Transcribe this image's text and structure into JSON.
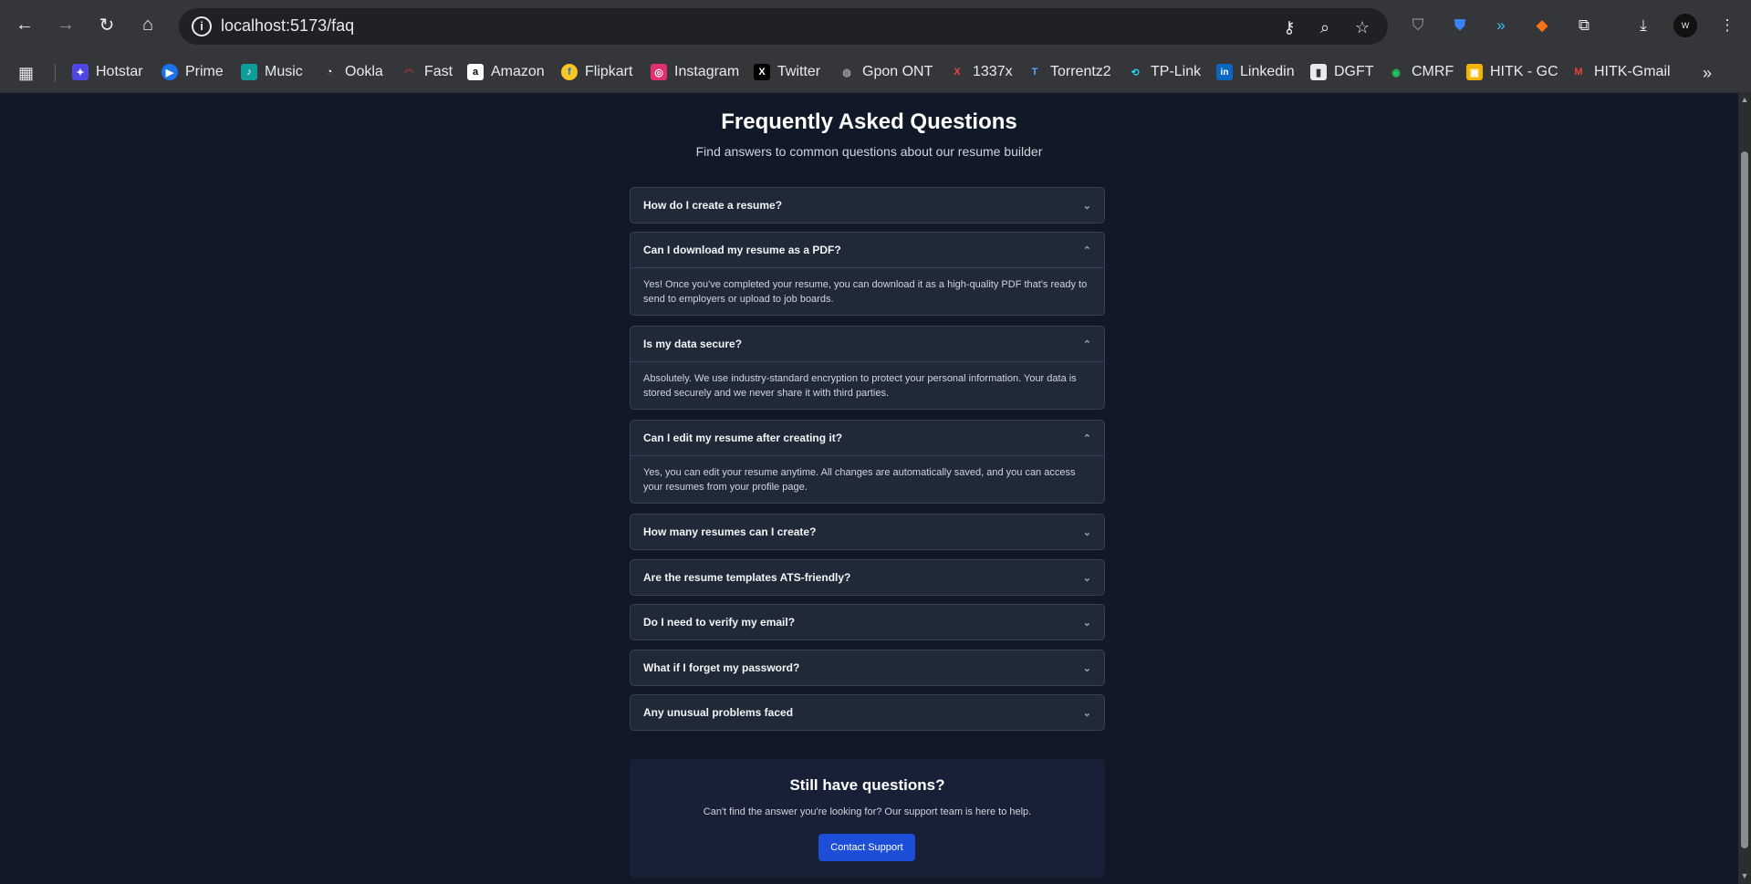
{
  "browser": {
    "url": "localhost:5173/faq",
    "bookmarks": [
      {
        "label": "Hotstar",
        "color": "#4f46e5",
        "glyph": "✦"
      },
      {
        "label": "Prime",
        "color": "#1a73e8",
        "glyph": "▶"
      },
      {
        "label": "Music",
        "color": "#0f9d9a",
        "glyph": "♪"
      },
      {
        "label": "Ookla",
        "color": "#35363a",
        "glyph": "◔"
      },
      {
        "label": "Fast",
        "color": "#c62828",
        "glyph": "◠"
      },
      {
        "label": "Amazon",
        "color": "#ffffff",
        "glyph": "a"
      },
      {
        "label": "Flipkart",
        "color": "#f9c623",
        "glyph": "f"
      },
      {
        "label": "Instagram",
        "color": "#e1306c",
        "glyph": "◎"
      },
      {
        "label": "Twitter",
        "color": "#000000",
        "glyph": "X"
      },
      {
        "label": "Gpon ONT",
        "color": "#9aa0a6",
        "glyph": "◍"
      },
      {
        "label": "1337x",
        "color": "#35363a",
        "glyph": "X"
      },
      {
        "label": "Torrentz2",
        "color": "#35363a",
        "glyph": "T"
      },
      {
        "label": "TP-Link",
        "color": "#35363a",
        "glyph": "⟲"
      },
      {
        "label": "Linkedin",
        "color": "#0a66c2",
        "glyph": "in"
      },
      {
        "label": "DGFT",
        "color": "#e8eaed",
        "glyph": "▮"
      },
      {
        "label": "CMRF",
        "color": "#35363a",
        "glyph": "◉"
      },
      {
        "label": "HITK - GC",
        "color": "#f4b400",
        "glyph": "▣"
      },
      {
        "label": "HITK-Gmail",
        "color": "#35363a",
        "glyph": "M"
      }
    ]
  },
  "page": {
    "title": "Frequently Asked Questions",
    "subtitle": "Find answers to common questions about our resume builder",
    "faqs": [
      {
        "question": "How do I create a resume?",
        "open": false,
        "answer": ""
      },
      {
        "question": "Can I download my resume as a PDF?",
        "open": true,
        "answer": "Yes! Once you've completed your resume, you can download it as a high-quality PDF that's ready to send to employers or upload to job boards."
      },
      {
        "question": "Is my data secure?",
        "open": true,
        "answer": "Absolutely. We use industry-standard encryption to protect your personal information. Your data is stored securely and we never share it with third parties."
      },
      {
        "question": "Can I edit my resume after creating it?",
        "open": true,
        "answer": "Yes, you can edit your resume anytime. All changes are automatically saved, and you can access your resumes from your profile page."
      },
      {
        "question": "How many resumes can I create?",
        "open": false,
        "answer": ""
      },
      {
        "question": "Are the resume templates ATS-friendly?",
        "open": false,
        "answer": ""
      },
      {
        "question": "Do I need to verify my email?",
        "open": false,
        "answer": ""
      },
      {
        "question": "What if I forget my password?",
        "open": false,
        "answer": ""
      },
      {
        "question": "Any unusual problems faced",
        "open": false,
        "answer": ""
      }
    ],
    "support": {
      "title": "Still have questions?",
      "text": "Can't find the answer you're looking for? Our support team is here to help.",
      "button": "Contact Support"
    }
  }
}
